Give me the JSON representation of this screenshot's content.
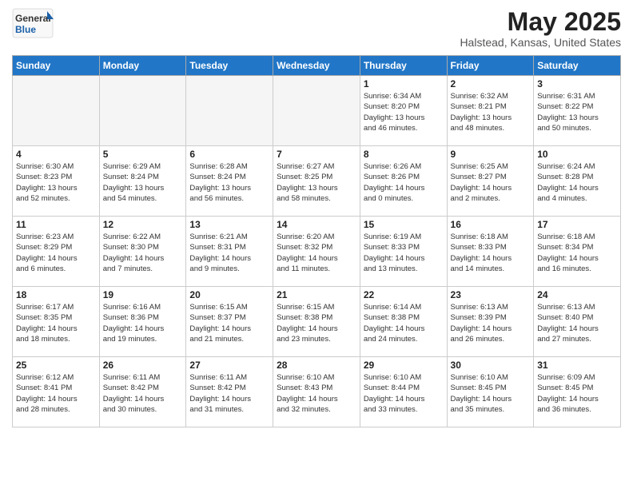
{
  "header": {
    "logo_general": "General",
    "logo_blue": "Blue",
    "month_title": "May 2025",
    "location": "Halstead, Kansas, United States"
  },
  "weekdays": [
    "Sunday",
    "Monday",
    "Tuesday",
    "Wednesday",
    "Thursday",
    "Friday",
    "Saturday"
  ],
  "weeks": [
    [
      {
        "day": "",
        "info": ""
      },
      {
        "day": "",
        "info": ""
      },
      {
        "day": "",
        "info": ""
      },
      {
        "day": "",
        "info": ""
      },
      {
        "day": "1",
        "info": "Sunrise: 6:34 AM\nSunset: 8:20 PM\nDaylight: 13 hours\nand 46 minutes."
      },
      {
        "day": "2",
        "info": "Sunrise: 6:32 AM\nSunset: 8:21 PM\nDaylight: 13 hours\nand 48 minutes."
      },
      {
        "day": "3",
        "info": "Sunrise: 6:31 AM\nSunset: 8:22 PM\nDaylight: 13 hours\nand 50 minutes."
      }
    ],
    [
      {
        "day": "4",
        "info": "Sunrise: 6:30 AM\nSunset: 8:23 PM\nDaylight: 13 hours\nand 52 minutes."
      },
      {
        "day": "5",
        "info": "Sunrise: 6:29 AM\nSunset: 8:24 PM\nDaylight: 13 hours\nand 54 minutes."
      },
      {
        "day": "6",
        "info": "Sunrise: 6:28 AM\nSunset: 8:24 PM\nDaylight: 13 hours\nand 56 minutes."
      },
      {
        "day": "7",
        "info": "Sunrise: 6:27 AM\nSunset: 8:25 PM\nDaylight: 13 hours\nand 58 minutes."
      },
      {
        "day": "8",
        "info": "Sunrise: 6:26 AM\nSunset: 8:26 PM\nDaylight: 14 hours\nand 0 minutes."
      },
      {
        "day": "9",
        "info": "Sunrise: 6:25 AM\nSunset: 8:27 PM\nDaylight: 14 hours\nand 2 minutes."
      },
      {
        "day": "10",
        "info": "Sunrise: 6:24 AM\nSunset: 8:28 PM\nDaylight: 14 hours\nand 4 minutes."
      }
    ],
    [
      {
        "day": "11",
        "info": "Sunrise: 6:23 AM\nSunset: 8:29 PM\nDaylight: 14 hours\nand 6 minutes."
      },
      {
        "day": "12",
        "info": "Sunrise: 6:22 AM\nSunset: 8:30 PM\nDaylight: 14 hours\nand 7 minutes."
      },
      {
        "day": "13",
        "info": "Sunrise: 6:21 AM\nSunset: 8:31 PM\nDaylight: 14 hours\nand 9 minutes."
      },
      {
        "day": "14",
        "info": "Sunrise: 6:20 AM\nSunset: 8:32 PM\nDaylight: 14 hours\nand 11 minutes."
      },
      {
        "day": "15",
        "info": "Sunrise: 6:19 AM\nSunset: 8:33 PM\nDaylight: 14 hours\nand 13 minutes."
      },
      {
        "day": "16",
        "info": "Sunrise: 6:18 AM\nSunset: 8:33 PM\nDaylight: 14 hours\nand 14 minutes."
      },
      {
        "day": "17",
        "info": "Sunrise: 6:18 AM\nSunset: 8:34 PM\nDaylight: 14 hours\nand 16 minutes."
      }
    ],
    [
      {
        "day": "18",
        "info": "Sunrise: 6:17 AM\nSunset: 8:35 PM\nDaylight: 14 hours\nand 18 minutes."
      },
      {
        "day": "19",
        "info": "Sunrise: 6:16 AM\nSunset: 8:36 PM\nDaylight: 14 hours\nand 19 minutes."
      },
      {
        "day": "20",
        "info": "Sunrise: 6:15 AM\nSunset: 8:37 PM\nDaylight: 14 hours\nand 21 minutes."
      },
      {
        "day": "21",
        "info": "Sunrise: 6:15 AM\nSunset: 8:38 PM\nDaylight: 14 hours\nand 23 minutes."
      },
      {
        "day": "22",
        "info": "Sunrise: 6:14 AM\nSunset: 8:38 PM\nDaylight: 14 hours\nand 24 minutes."
      },
      {
        "day": "23",
        "info": "Sunrise: 6:13 AM\nSunset: 8:39 PM\nDaylight: 14 hours\nand 26 minutes."
      },
      {
        "day": "24",
        "info": "Sunrise: 6:13 AM\nSunset: 8:40 PM\nDaylight: 14 hours\nand 27 minutes."
      }
    ],
    [
      {
        "day": "25",
        "info": "Sunrise: 6:12 AM\nSunset: 8:41 PM\nDaylight: 14 hours\nand 28 minutes."
      },
      {
        "day": "26",
        "info": "Sunrise: 6:11 AM\nSunset: 8:42 PM\nDaylight: 14 hours\nand 30 minutes."
      },
      {
        "day": "27",
        "info": "Sunrise: 6:11 AM\nSunset: 8:42 PM\nDaylight: 14 hours\nand 31 minutes."
      },
      {
        "day": "28",
        "info": "Sunrise: 6:10 AM\nSunset: 8:43 PM\nDaylight: 14 hours\nand 32 minutes."
      },
      {
        "day": "29",
        "info": "Sunrise: 6:10 AM\nSunset: 8:44 PM\nDaylight: 14 hours\nand 33 minutes."
      },
      {
        "day": "30",
        "info": "Sunrise: 6:10 AM\nSunset: 8:45 PM\nDaylight: 14 hours\nand 35 minutes."
      },
      {
        "day": "31",
        "info": "Sunrise: 6:09 AM\nSunset: 8:45 PM\nDaylight: 14 hours\nand 36 minutes."
      }
    ]
  ]
}
